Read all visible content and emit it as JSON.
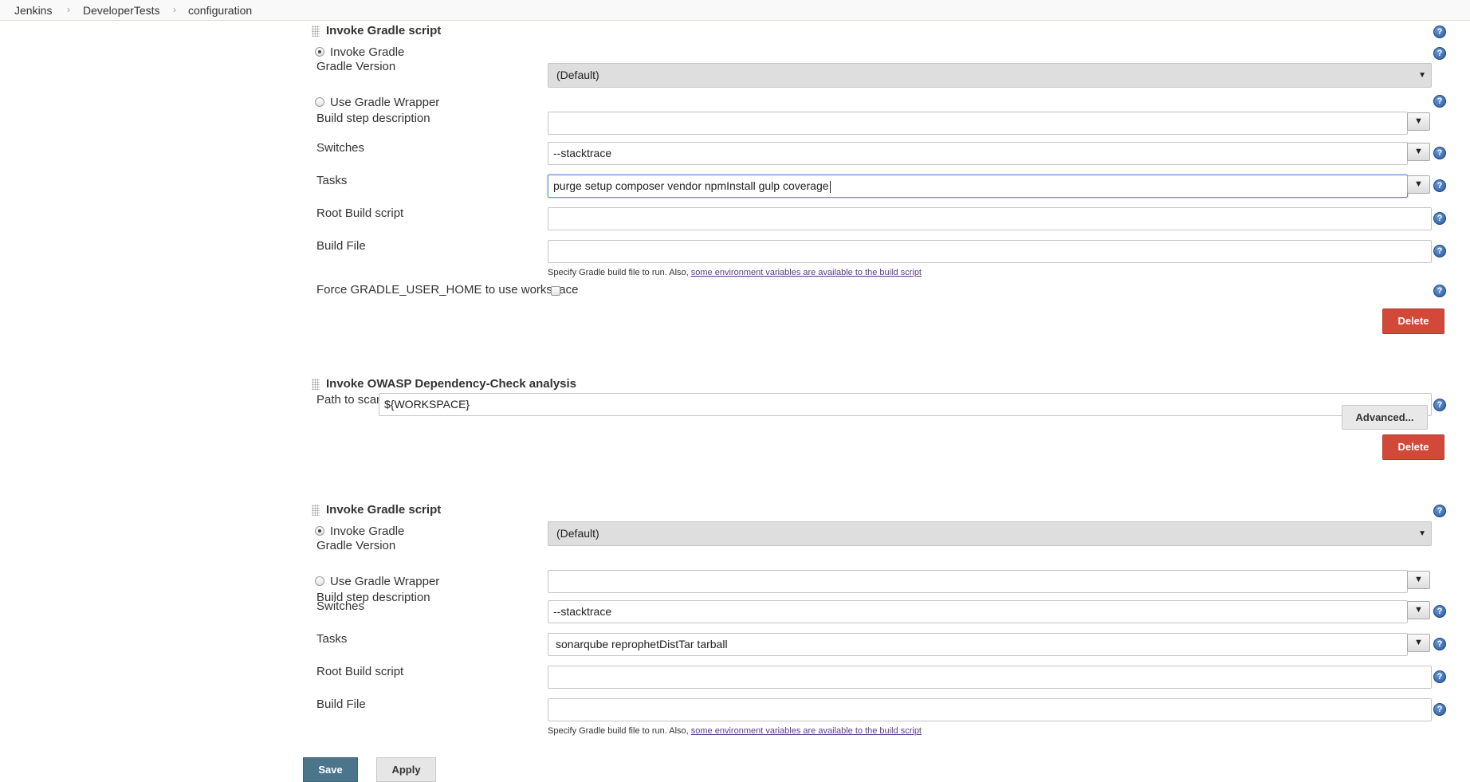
{
  "breadcrumb": {
    "items": [
      "Jenkins",
      "DeveloperTests",
      "configuration"
    ]
  },
  "gradle_step_1": {
    "title": "Invoke Gradle script",
    "invoke_gradle_label": "Invoke Gradle",
    "gradle_version_label": "Gradle Version",
    "gradle_version_value": "(Default)",
    "use_wrapper_label": "Use Gradle Wrapper",
    "build_step_description_label": "Build step description",
    "build_step_description_value": "",
    "switches_label": "Switches",
    "switches_value": "--stacktrace",
    "tasks_label": "Tasks",
    "tasks_value": "purge setup composer vendor npmInstall gulp coverage",
    "root_build_script_label": "Root Build script",
    "root_build_script_value": "",
    "build_file_label": "Build File",
    "build_file_value": "",
    "build_file_hint": "Specify Gradle build file to run. Also,",
    "build_file_hint_link": "some environment variables are available to the build script",
    "force_home_label": "Force GRADLE_USER_HOME to use workspace",
    "delete_label": "Delete"
  },
  "owasp_step": {
    "title": "Invoke OWASP Dependency-Check analysis",
    "path_label": "Path to scan",
    "path_value": "${WORKSPACE}",
    "advanced_label": "Advanced...",
    "delete_label": "Delete"
  },
  "gradle_step_2": {
    "title": "Invoke Gradle script",
    "invoke_gradle_label": "Invoke Gradle",
    "gradle_version_label": "Gradle Version",
    "gradle_version_value": "(Default)",
    "use_wrapper_label": "Use Gradle Wrapper",
    "build_step_description_label": "Build step description",
    "build_step_description_value": "",
    "switches_label": "Switches",
    "switches_value": "--stacktrace",
    "tasks_label": "Tasks",
    "tasks_value": "sonarqube reprophetDistTar tarball",
    "root_build_script_label": "Root Build script",
    "root_build_script_value": "",
    "build_file_label": "Build File",
    "build_file_value": "",
    "build_file_hint": "Specify Gradle build file to run. Also,",
    "build_file_hint_link": "some environment variables are available to the build script"
  },
  "footer": {
    "save_label": "Save",
    "apply_label": "Apply"
  },
  "icons": {
    "help": "help-icon",
    "dropdown": "chevron-down-icon"
  },
  "colors": {
    "delete": "#d24939",
    "save": "#4b758b",
    "help": "#23579c",
    "link": "#5b3a8a"
  }
}
